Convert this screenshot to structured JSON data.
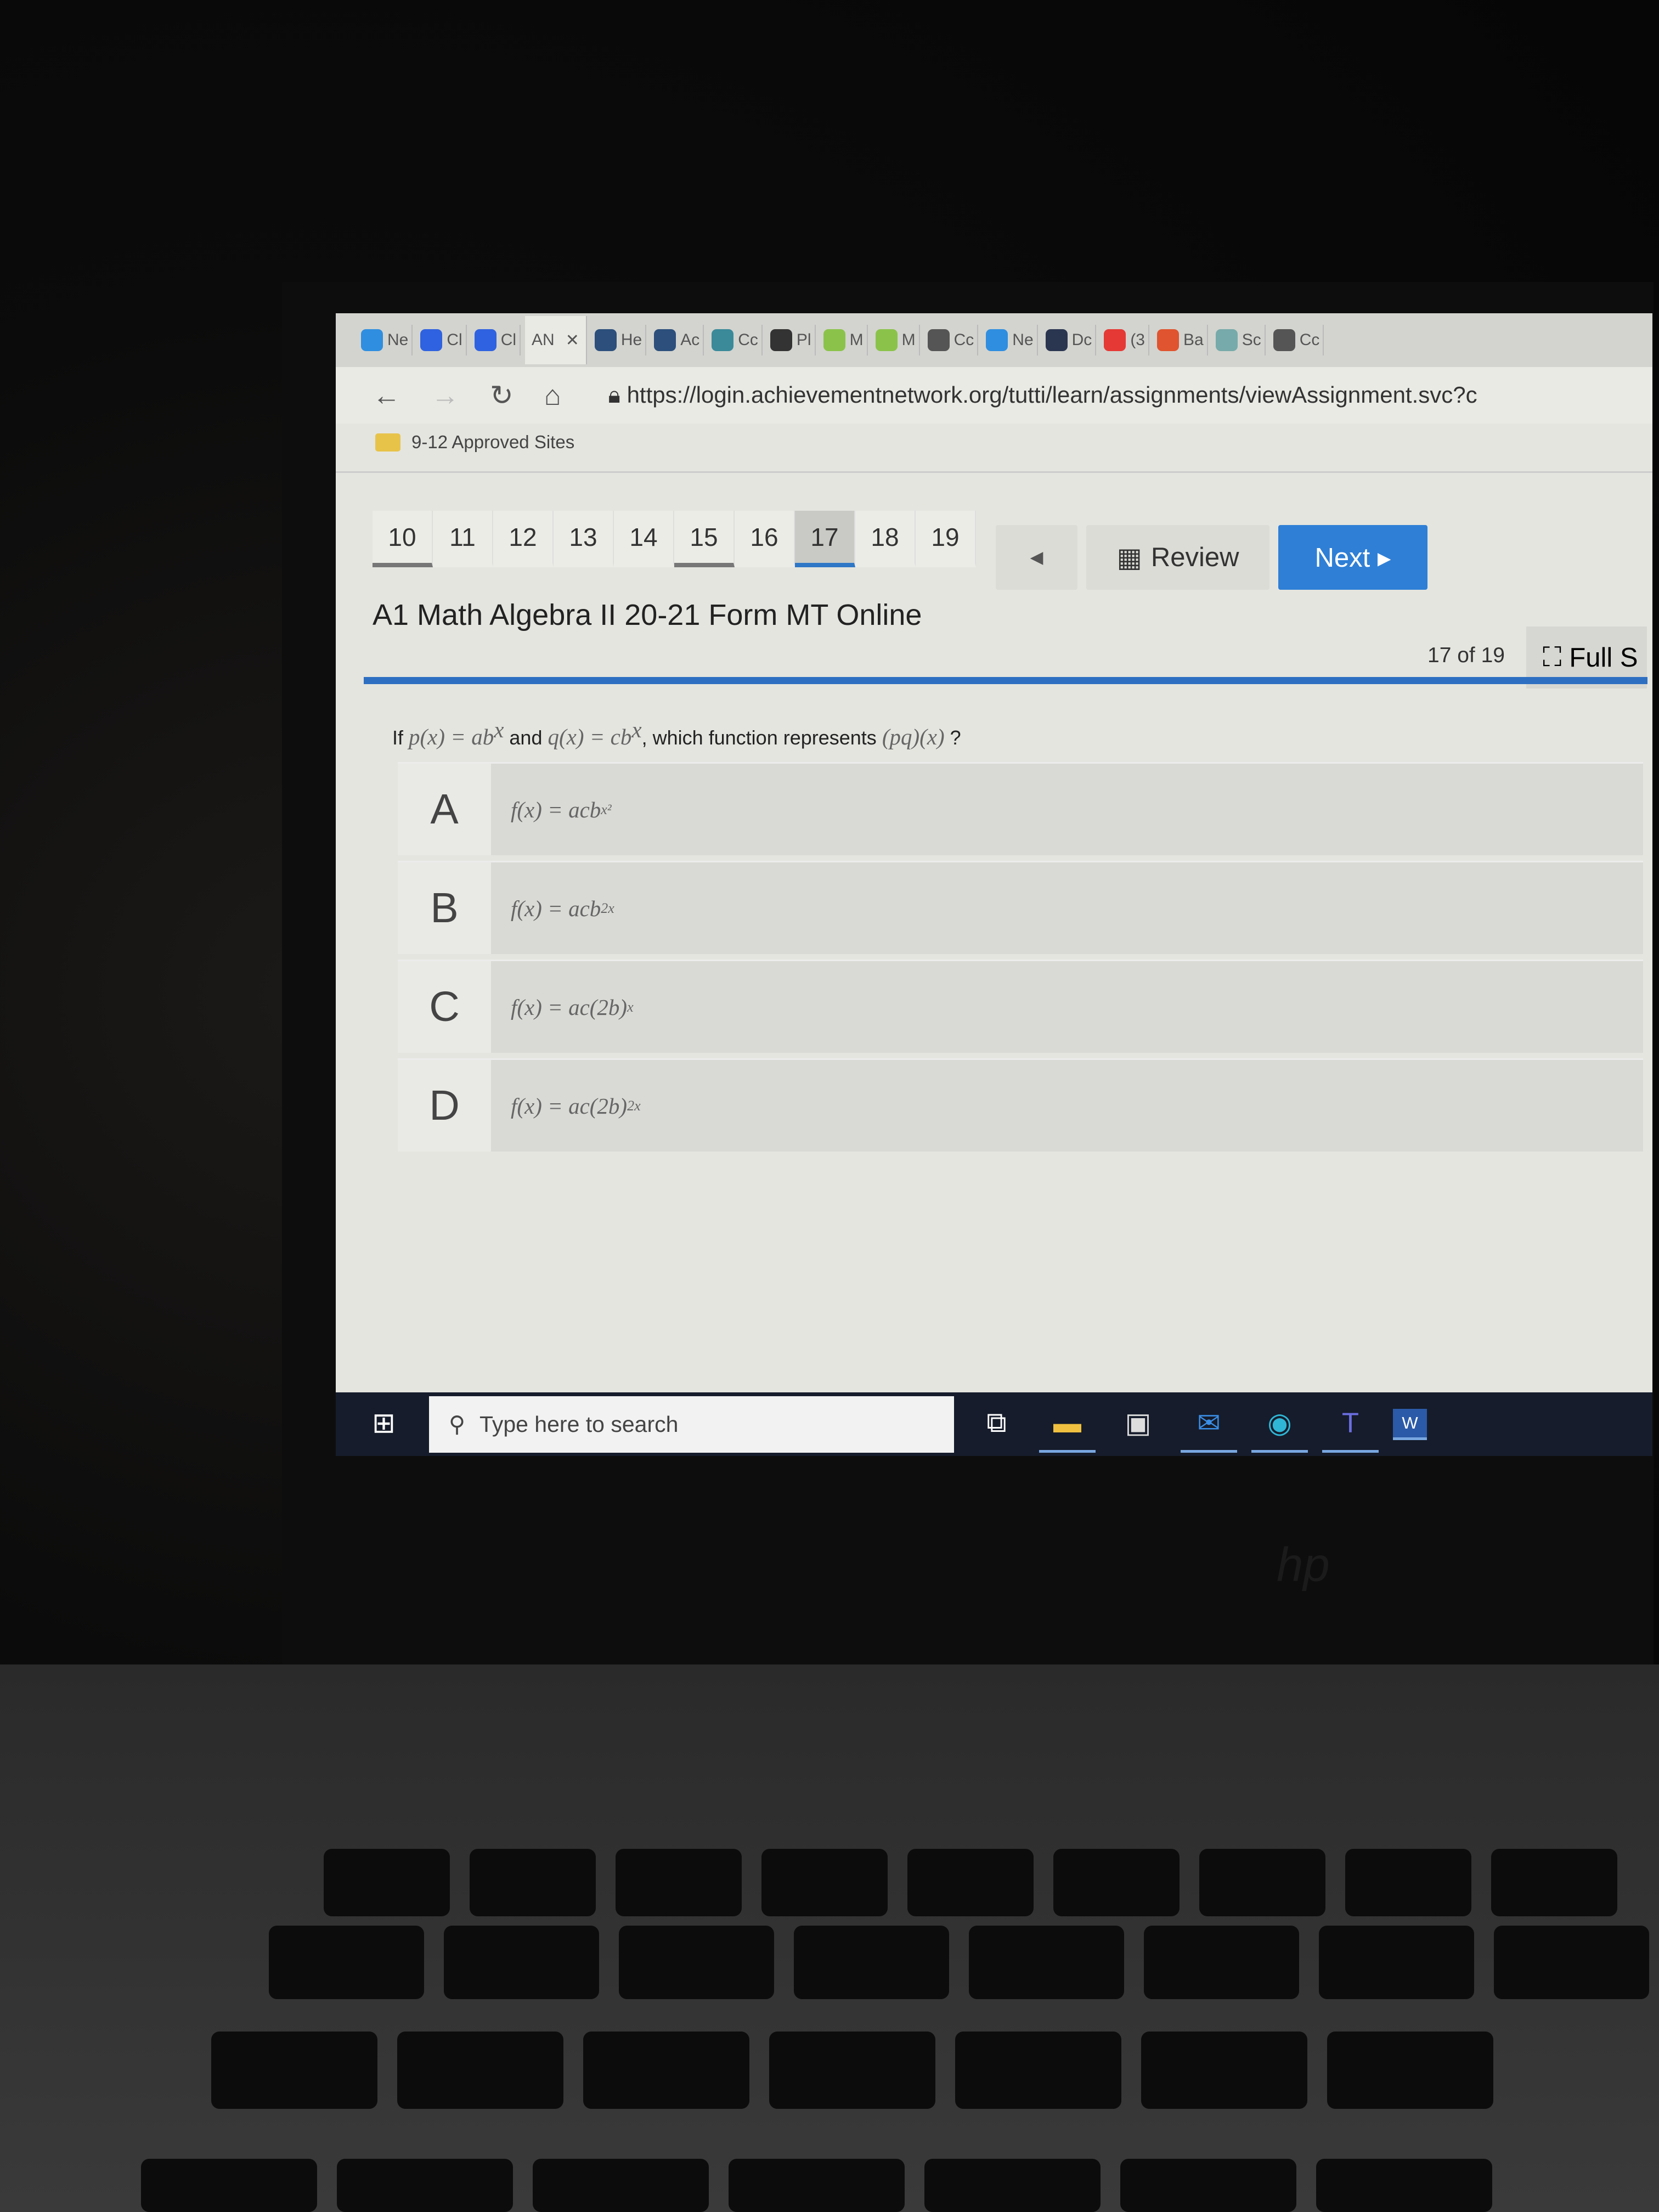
{
  "browser": {
    "tabs": [
      {
        "label": "Ne",
        "icon": "compass-icon",
        "color": "#2f8ee0"
      },
      {
        "label": "Cl",
        "icon": "c-icon",
        "color": "#2f62e0"
      },
      {
        "label": "Cl",
        "icon": "c-icon",
        "color": "#2f62e0"
      },
      {
        "label": "AN",
        "icon": "",
        "color": "",
        "active": true
      },
      {
        "label": "He",
        "icon": "a-icon",
        "color": "#2c4f7c"
      },
      {
        "label": "Ac",
        "icon": "a-icon",
        "color": "#2c4f7c"
      },
      {
        "label": "Cc",
        "icon": "star-icon",
        "color": "#3a8a9a"
      },
      {
        "label": "Pl",
        "icon": "power-icon",
        "color": "#333333"
      },
      {
        "label": "M",
        "icon": "molecule-icon",
        "color": "#8bc34a"
      },
      {
        "label": "M",
        "icon": "molecule-icon",
        "color": "#8bc34a"
      },
      {
        "label": "Cc",
        "icon": "document-icon",
        "color": "#555555"
      },
      {
        "label": "Ne",
        "icon": "compass-icon",
        "color": "#2f8ee0"
      },
      {
        "label": "Dc",
        "icon": "graduation-icon",
        "color": "#2a3550"
      },
      {
        "label": "(3",
        "icon": "youtube-icon",
        "color": "#e53935"
      },
      {
        "label": "Ba",
        "icon": "flask-icon",
        "color": "#e0542f"
      },
      {
        "label": "Sc",
        "icon": "person-icon",
        "color": "#7aa"
      },
      {
        "label": "Cc",
        "icon": "document-icon",
        "color": "#555555"
      }
    ],
    "close_glyph": "✕",
    "url": "https://login.achievementnetwork.org/tutti/learn/assignments/viewAssignment.svc?c",
    "bookmark": "9-12 Approved Sites"
  },
  "nav": {
    "questions": [
      {
        "n": "10",
        "state": "done"
      },
      {
        "n": "11",
        "state": ""
      },
      {
        "n": "12",
        "state": ""
      },
      {
        "n": "13",
        "state": ""
      },
      {
        "n": "14",
        "state": ""
      },
      {
        "n": "15",
        "state": "done"
      },
      {
        "n": "16",
        "state": ""
      },
      {
        "n": "17",
        "state": "cur"
      },
      {
        "n": "18",
        "state": ""
      },
      {
        "n": "19",
        "state": ""
      }
    ],
    "prev_glyph": "◀",
    "review_label": "Review",
    "next_label": "Next ▸",
    "progress": "17 of 19",
    "fullscreen_label": "Full S"
  },
  "assessment_title": "A1 Math Algebra II 20-21 Form MT Online",
  "question": {
    "parts": [
      "If ",
      "p(x)",
      " = ",
      "ab",
      "x",
      " and ",
      "q(x)",
      " = ",
      "cb",
      "x",
      ", which function represents ",
      "(pq)(x)",
      " ?"
    ],
    "options": [
      {
        "letter": "A",
        "base": "f(x) = acb",
        "exp": "x²"
      },
      {
        "letter": "B",
        "base": "f(x) = acb",
        "exp": "2x"
      },
      {
        "letter": "C",
        "base": "f(x) = ac(2b)",
        "exp": "x"
      },
      {
        "letter": "D",
        "base": "f(x) = ac(2b)",
        "exp": "2x"
      }
    ]
  },
  "taskbar": {
    "search_placeholder": "Type here to search",
    "brand": "hp"
  },
  "colors": {
    "accent": "#2e6fc2",
    "next_button": "#2f7fd6"
  }
}
